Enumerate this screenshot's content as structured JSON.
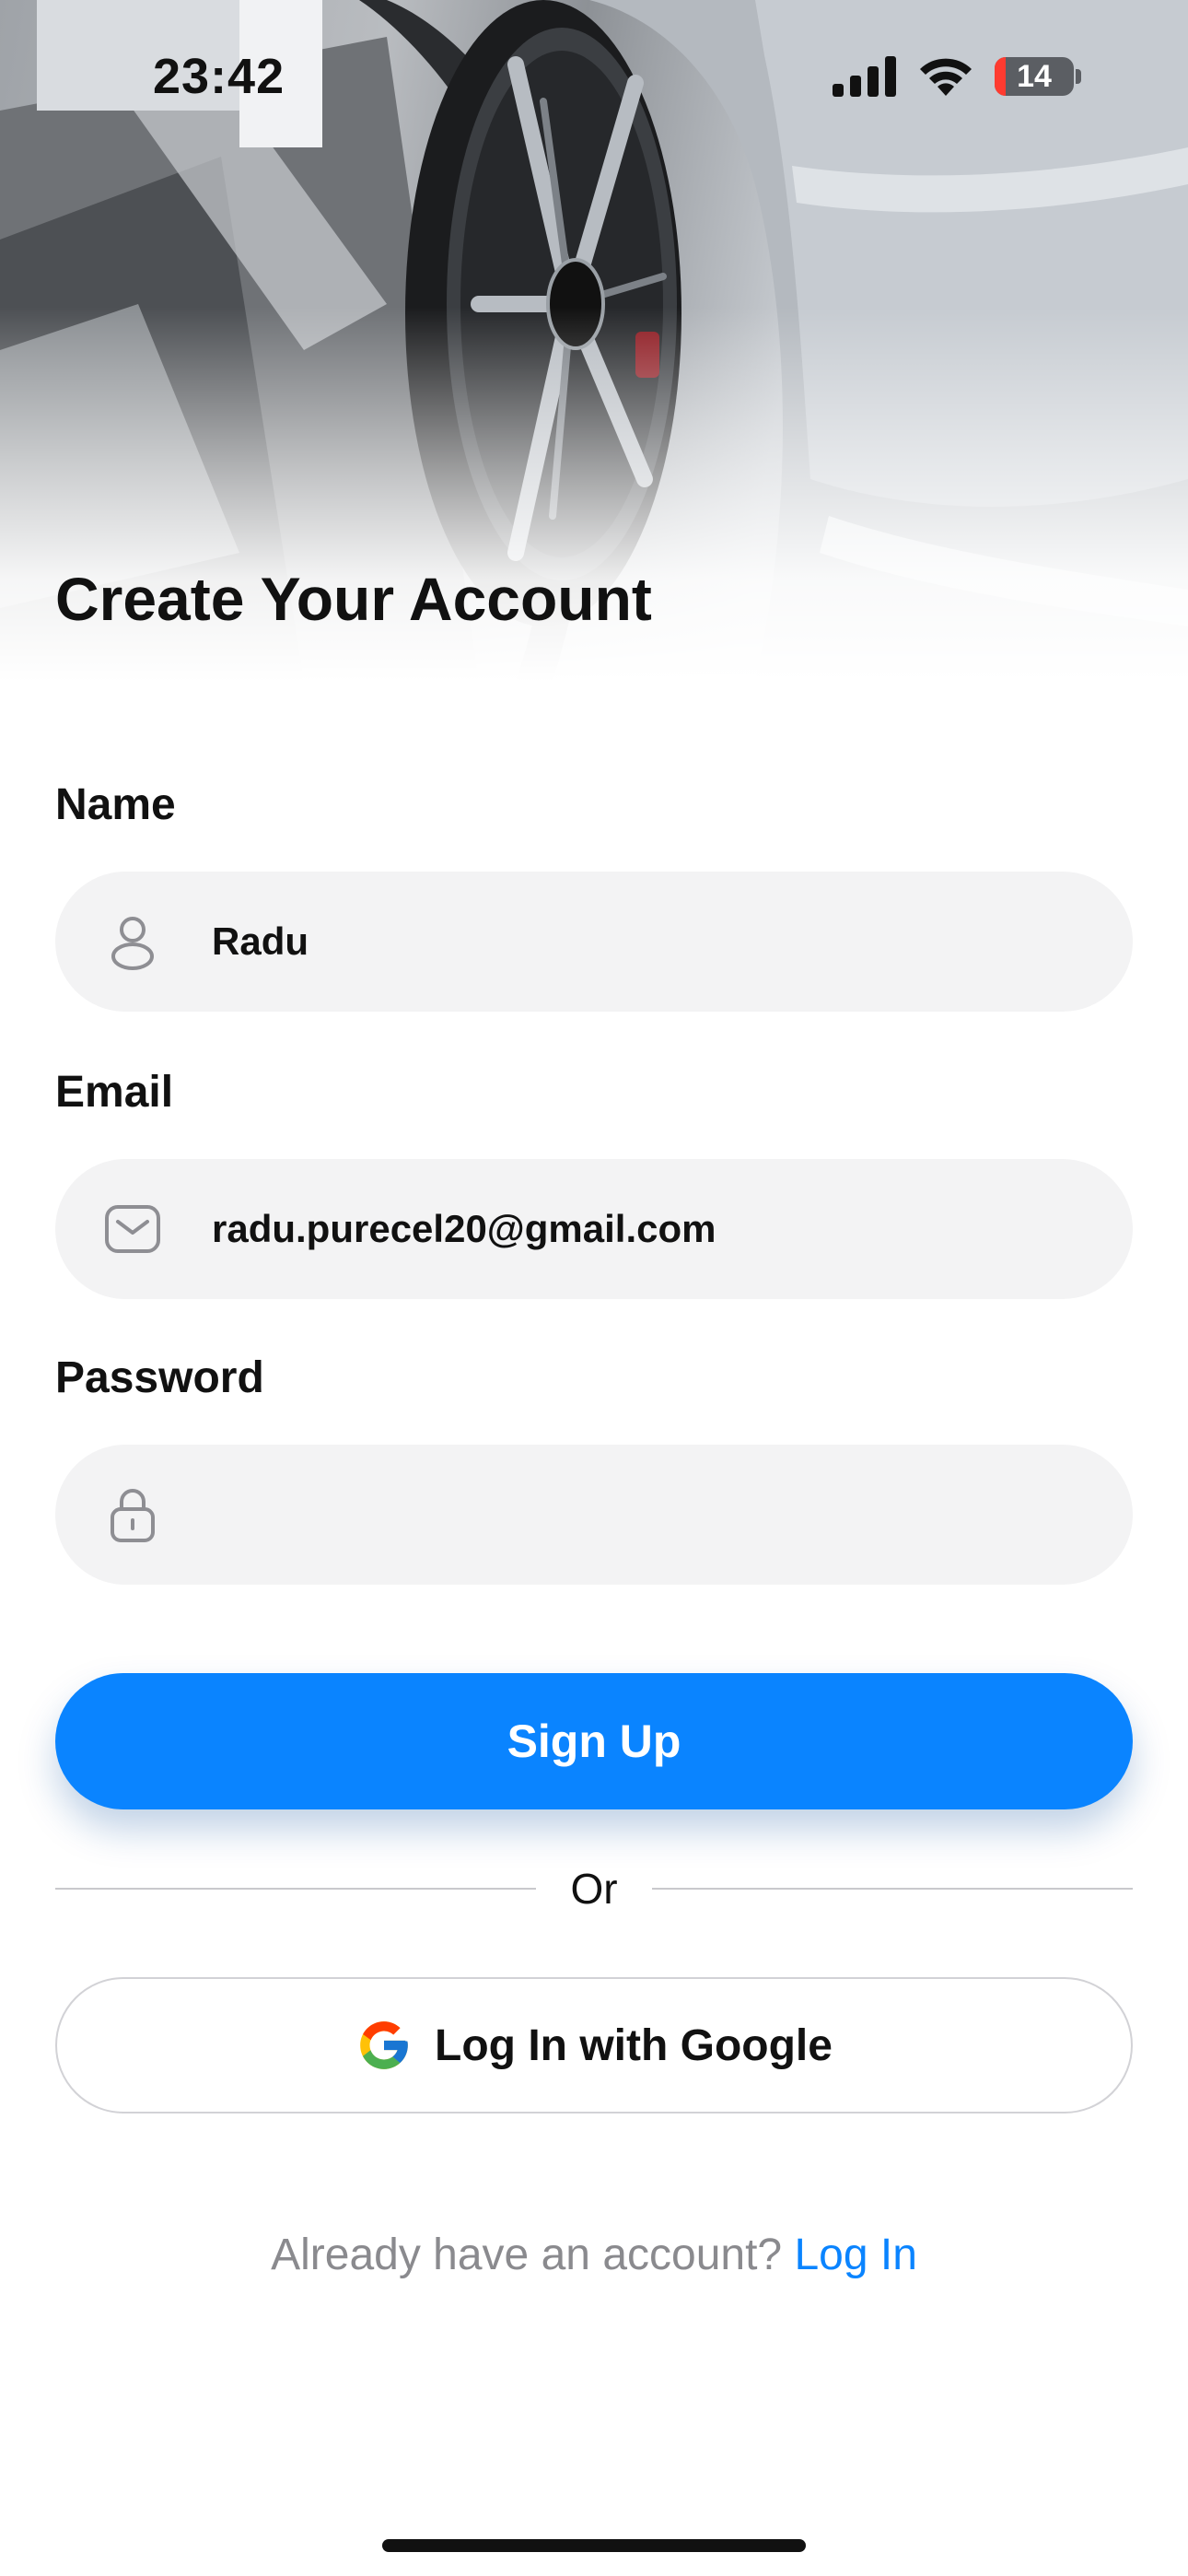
{
  "status_bar": {
    "time": "23:42",
    "battery_level": "14",
    "battery_color": "#ff3b30"
  },
  "header": {
    "title": "Create Your Account",
    "image": "car-wheel-photo"
  },
  "form": {
    "name": {
      "label": "Name",
      "value": "Radu",
      "icon": "person-icon"
    },
    "email": {
      "label": "Email",
      "value": "radu.purecel20@gmail.com",
      "icon": "mail-icon"
    },
    "password": {
      "label": "Password",
      "value": "",
      "icon": "lock-icon"
    }
  },
  "actions": {
    "signup_label": "Sign Up",
    "divider_label": "Or",
    "google_label": "Log In with Google"
  },
  "footer": {
    "prompt_text": "Already have an account?",
    "login_link": "Log In"
  },
  "colors": {
    "accent": "#0a84ff",
    "field_background": "#f3f3f4",
    "muted_text": "#8a8a8e"
  }
}
